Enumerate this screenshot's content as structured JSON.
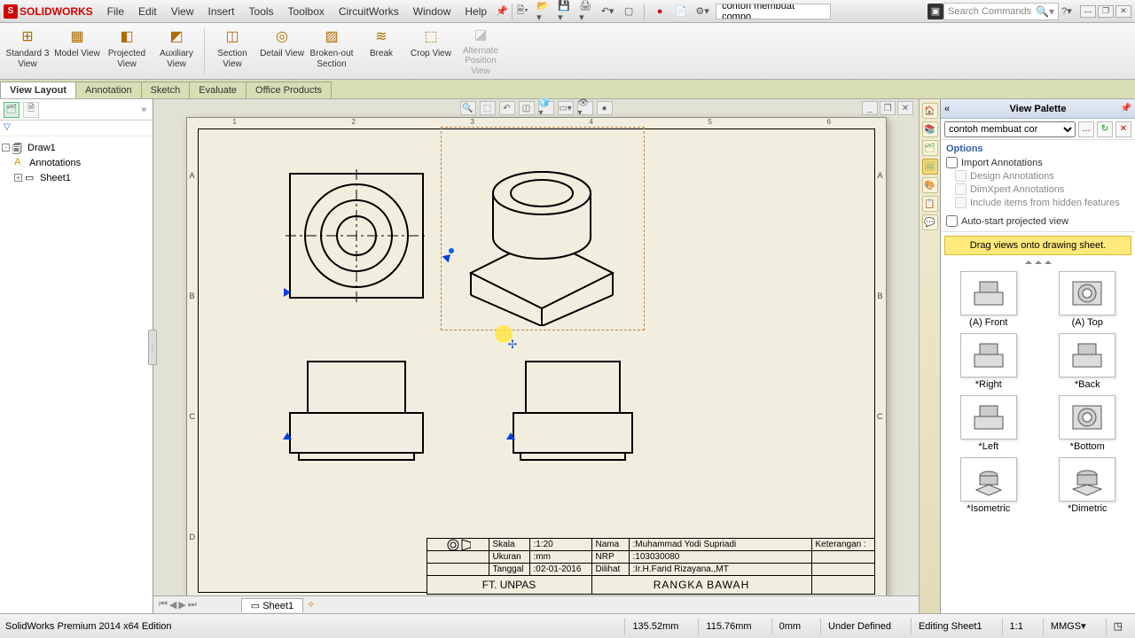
{
  "app": {
    "brand": "SOLIDWORKS"
  },
  "menus": [
    "File",
    "Edit",
    "View",
    "Insert",
    "Tools",
    "Toolbox",
    "CircuitWorks",
    "Window",
    "Help"
  ],
  "title_doc": "contoh membuat compo...",
  "search_placeholder": "Search Commands",
  "ribbon": [
    {
      "label": "Standard 3 View",
      "dis": false
    },
    {
      "label": "Model View",
      "dis": false
    },
    {
      "label": "Projected View",
      "dis": false
    },
    {
      "label": "Auxiliary View",
      "dis": false
    },
    {
      "label": "Section View",
      "dis": false
    },
    {
      "label": "Detail View",
      "dis": false
    },
    {
      "label": "Broken-out Section",
      "dis": false
    },
    {
      "label": "Break",
      "dis": false
    },
    {
      "label": "Crop View",
      "dis": false
    },
    {
      "label": "Alternate Position View",
      "dis": true
    }
  ],
  "cmd_tabs": [
    "View Layout",
    "Annotation",
    "Sketch",
    "Evaluate",
    "Office Products"
  ],
  "cmd_tab_active": 0,
  "tree": {
    "root": "Draw1",
    "children": [
      "Annotations",
      "Sheet1"
    ]
  },
  "sheet_tab": "Sheet1",
  "ruler_cols": [
    "1",
    "2",
    "3",
    "4",
    "5",
    "6"
  ],
  "ruler_rows": [
    "A",
    "B",
    "C",
    "D"
  ],
  "title_block": {
    "skala_label": "Skala",
    "skala": "1:20",
    "ukuran_label": "Ukuran",
    "ukuran": "mm",
    "tanggal_label": "Tanggal",
    "tanggal": "02-01-2016",
    "nama_label": "Nama",
    "nama": "Muhammad Yodi Supriadi",
    "nrp_label": "NRP",
    "nrp": "103030080",
    "dilihat_label": "Dilihat",
    "dilihat": "Ir.H.Farid Rizayana.,MT",
    "keterangan_label": "Keterangan :",
    "org": "FT. UNPAS",
    "title": "RANGKA BAWAH"
  },
  "palette": {
    "title": "View Palette",
    "doc": "contoh membuat cor",
    "options_header": "Options",
    "import": "Import Annotations",
    "design": "Design Annotations",
    "dimxpert": "DimXpert Annotations",
    "hidden": "Include items from hidden features",
    "autostart": "Auto-start projected view",
    "banner": "Drag views onto drawing sheet.",
    "views": [
      "(A) Front",
      "(A) Top",
      "*Right",
      "*Back",
      "*Left",
      "*Bottom",
      "*Isometric",
      "*Dimetric"
    ]
  },
  "status": {
    "edition": "SolidWorks Premium 2014 x64 Edition",
    "x": "135.52mm",
    "y": "115.76mm",
    "z": "0mm",
    "def": "Under Defined",
    "mode": "Editing Sheet1",
    "scale": "1:1",
    "units": "MMGS"
  }
}
